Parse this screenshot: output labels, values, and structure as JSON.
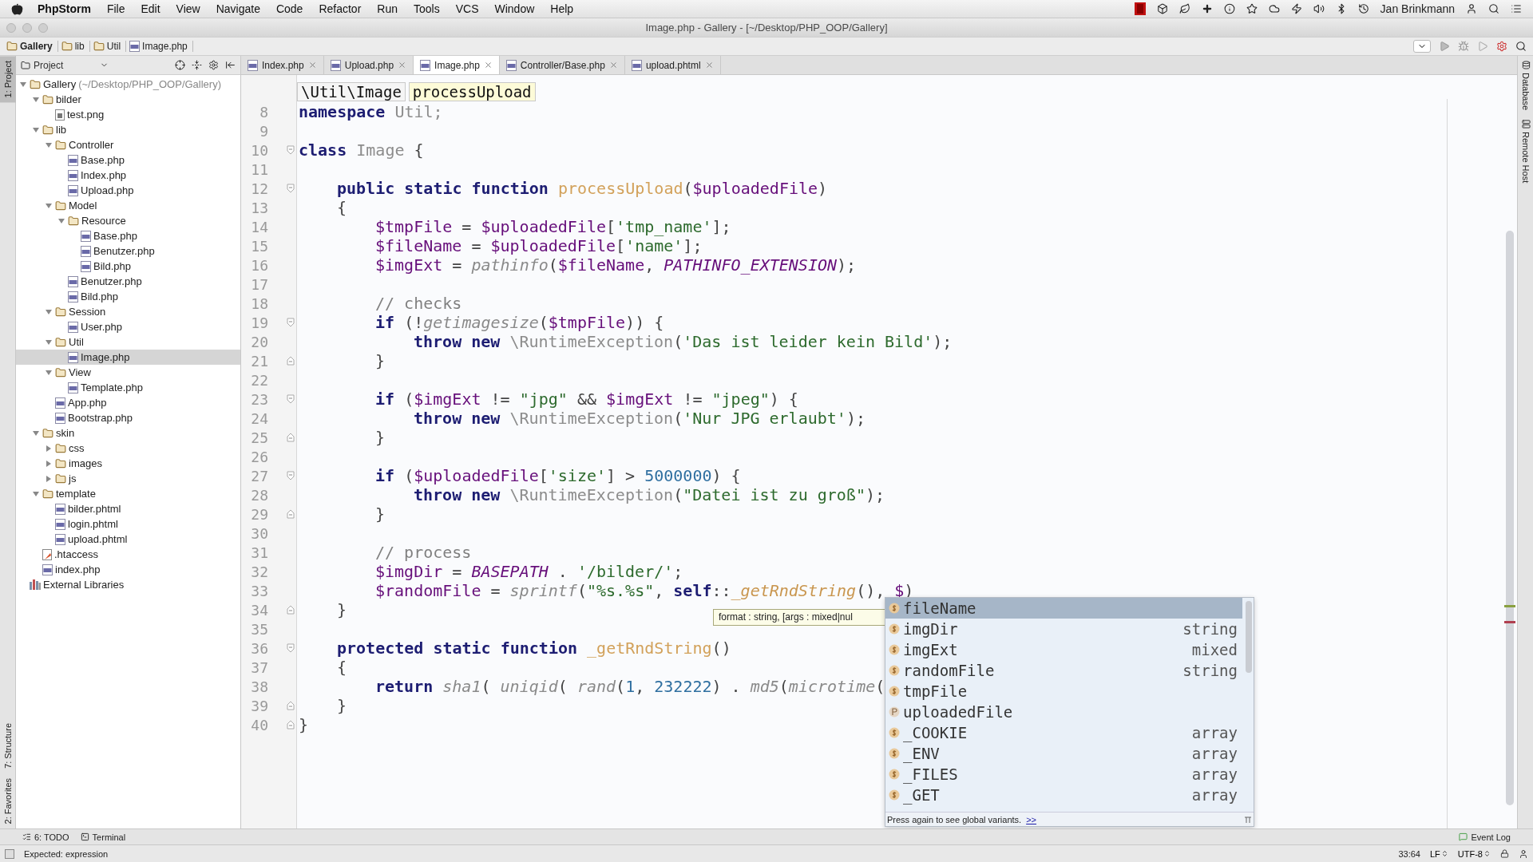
{
  "menu_bar": {
    "app": "PhpStorm",
    "items": [
      "File",
      "Edit",
      "View",
      "Navigate",
      "Code",
      "Refactor",
      "Run",
      "Tools",
      "VCS",
      "Window",
      "Help"
    ],
    "user": "Jan Brinkmann"
  },
  "window": {
    "title": "Image.php - Gallery - [~/Desktop/PHP_OOP/Gallery]"
  },
  "breadcrumbs": [
    "Gallery",
    "lib",
    "Util",
    "Image.php"
  ],
  "left_tool_strip": {
    "top": [
      {
        "label": "1: Project",
        "selected": true
      }
    ],
    "bottom": [
      {
        "label": "7: Structure",
        "selected": false
      },
      {
        "label": "2: Favorites",
        "selected": false
      }
    ]
  },
  "project_panel": {
    "title": "Project",
    "tree": [
      {
        "label": "Gallery",
        "hint": "(~/Desktop/PHP_OOP/Gallery)",
        "kind": "folder",
        "expanded": true,
        "selected": false,
        "children": [
          {
            "label": "bilder",
            "kind": "folder",
            "expanded": true,
            "selected": false,
            "children": [
              {
                "label": "test.png",
                "kind": "image",
                "selected": false
              }
            ]
          },
          {
            "label": "lib",
            "kind": "folder",
            "expanded": true,
            "selected": false,
            "children": [
              {
                "label": "Controller",
                "kind": "folder",
                "expanded": true,
                "selected": false,
                "children": [
                  {
                    "label": "Base.php",
                    "kind": "php",
                    "selected": false
                  },
                  {
                    "label": "Index.php",
                    "kind": "php",
                    "selected": false
                  },
                  {
                    "label": "Upload.php",
                    "kind": "php",
                    "selected": false
                  }
                ]
              },
              {
                "label": "Model",
                "kind": "folder",
                "expanded": true,
                "selected": false,
                "children": [
                  {
                    "label": "Resource",
                    "kind": "folder",
                    "expanded": true,
                    "selected": false,
                    "children": [
                      {
                        "label": "Base.php",
                        "kind": "php",
                        "selected": false
                      },
                      {
                        "label": "Benutzer.php",
                        "kind": "php",
                        "selected": false
                      },
                      {
                        "label": "Bild.php",
                        "kind": "php",
                        "selected": false
                      }
                    ]
                  },
                  {
                    "label": "Benutzer.php",
                    "kind": "php",
                    "selected": false
                  },
                  {
                    "label": "Bild.php",
                    "kind": "php",
                    "selected": false
                  }
                ]
              },
              {
                "label": "Session",
                "kind": "folder",
                "expanded": true,
                "selected": false,
                "children": [
                  {
                    "label": "User.php",
                    "kind": "php",
                    "selected": false
                  }
                ]
              },
              {
                "label": "Util",
                "kind": "folder",
                "expanded": true,
                "selected": false,
                "children": [
                  {
                    "label": "Image.php",
                    "kind": "php",
                    "selected": true
                  }
                ]
              },
              {
                "label": "View",
                "kind": "folder",
                "expanded": true,
                "selected": false,
                "children": [
                  {
                    "label": "Template.php",
                    "kind": "php",
                    "selected": false
                  }
                ]
              },
              {
                "label": "App.php",
                "kind": "php",
                "selected": false
              },
              {
                "label": "Bootstrap.php",
                "kind": "php",
                "selected": false
              }
            ]
          },
          {
            "label": "skin",
            "kind": "folder",
            "expanded": true,
            "selected": false,
            "children": [
              {
                "label": "css",
                "kind": "folder",
                "expanded": false,
                "selected": false
              },
              {
                "label": "images",
                "kind": "folder",
                "expanded": false,
                "selected": false
              },
              {
                "label": "js",
                "kind": "folder",
                "expanded": false,
                "selected": false
              }
            ]
          },
          {
            "label": "template",
            "kind": "folder",
            "expanded": true,
            "selected": false,
            "children": [
              {
                "label": "bilder.phtml",
                "kind": "php",
                "selected": false
              },
              {
                "label": "login.phtml",
                "kind": "php",
                "selected": false
              },
              {
                "label": "upload.phtml",
                "kind": "php",
                "selected": false
              }
            ]
          },
          {
            "label": ".htaccess",
            "kind": "config",
            "selected": false
          },
          {
            "label": "index.php",
            "kind": "php",
            "selected": false
          }
        ]
      },
      {
        "label": "External Libraries",
        "kind": "library",
        "selected": false
      }
    ]
  },
  "editor_tabs": [
    {
      "label": "Index.php",
      "selected": false
    },
    {
      "label": "Upload.php",
      "selected": false
    },
    {
      "label": "Image.php",
      "selected": true
    },
    {
      "label": "Controller/Base.php",
      "selected": false
    },
    {
      "label": "upload.phtml",
      "selected": false
    }
  ],
  "editor": {
    "breadcrumb": [
      "\\Util\\Image",
      "processUpload"
    ],
    "lines": [
      {
        "number": "8",
        "tokens": [
          {
            "kind": "kw",
            "text": "namespace"
          },
          {
            "kind": "cls",
            "text": " Util;"
          }
        ]
      },
      {
        "number": "9"
      },
      {
        "number": "10",
        "fold_start": true,
        "tokens": [
          {
            "kind": "kw",
            "text": "class"
          },
          {
            "kind": "cls",
            "text": " Image"
          },
          {
            "kind": "plain",
            "text": " {"
          }
        ],
        "children": [
          {
            "number": "11"
          },
          {
            "number": "12",
            "fold_start": true,
            "tokens": [
              {
                "kind": "kw",
                "text": "public static function"
              },
              {
                "kind": "fn",
                "text": " processUpload"
              },
              {
                "kind": "plain",
                "text": "("
              },
              {
                "kind": "var",
                "text": "$uploadedFile"
              },
              {
                "kind": "plain",
                "text": ")"
              }
            ]
          },
          {
            "number": "13",
            "tokens": [
              {
                "kind": "plain",
                "text": "{"
              }
            ],
            "children": [
              {
                "number": "14",
                "tokens": [
                  {
                    "kind": "var",
                    "text": "$tmpFile"
                  },
                  {
                    "kind": "plain",
                    "text": " = "
                  },
                  {
                    "kind": "var",
                    "text": "$uploadedFile"
                  },
                  {
                    "kind": "plain",
                    "text": "["
                  },
                  {
                    "kind": "str",
                    "text": "'tmp_name'"
                  },
                  {
                    "kind": "plain",
                    "text": "];"
                  }
                ]
              },
              {
                "number": "15",
                "tokens": [
                  {
                    "kind": "var",
                    "text": "$fileName"
                  },
                  {
                    "kind": "plain",
                    "text": " = "
                  },
                  {
                    "kind": "var",
                    "text": "$uploadedFile"
                  },
                  {
                    "kind": "plain",
                    "text": "["
                  },
                  {
                    "kind": "str",
                    "text": "'name'"
                  },
                  {
                    "kind": "plain",
                    "text": "];"
                  }
                ]
              },
              {
                "number": "16",
                "tokens": [
                  {
                    "kind": "var",
                    "text": "$imgExt"
                  },
                  {
                    "kind": "plain",
                    "text": " = "
                  },
                  {
                    "kind": "call",
                    "text": "pathinfo"
                  },
                  {
                    "kind": "plain",
                    "text": "("
                  },
                  {
                    "kind": "var",
                    "text": "$fileName"
                  },
                  {
                    "kind": "plain",
                    "text": ", "
                  },
                  {
                    "kind": "const",
                    "text": "PATHINFO_EXTENSION"
                  },
                  {
                    "kind": "plain",
                    "text": ");"
                  }
                ]
              },
              {
                "number": "17"
              },
              {
                "number": "18",
                "tokens": [
                  {
                    "kind": "cmt",
                    "text": "// checks"
                  }
                ]
              },
              {
                "number": "19",
                "fold_start": true,
                "tokens": [
                  {
                    "kind": "kw",
                    "text": "if"
                  },
                  {
                    "kind": "plain",
                    "text": " (!"
                  },
                  {
                    "kind": "call",
                    "text": "getimagesize"
                  },
                  {
                    "kind": "plain",
                    "text": "("
                  },
                  {
                    "kind": "var",
                    "text": "$tmpFile"
                  },
                  {
                    "kind": "plain",
                    "text": ")) {"
                  }
                ],
                "children": [
                  {
                    "number": "20",
                    "tokens": [
                      {
                        "kind": "kw",
                        "text": "throw new"
                      },
                      {
                        "kind": "cls",
                        "text": " \\RuntimeException"
                      },
                      {
                        "kind": "plain",
                        "text": "("
                      },
                      {
                        "kind": "str",
                        "text": "'Das ist leider kein Bild'"
                      },
                      {
                        "kind": "plain",
                        "text": ");"
                      }
                    ]
                  }
                ]
              },
              {
                "number": "21",
                "fold_end": true,
                "tokens": [
                  {
                    "kind": "plain",
                    "text": "}"
                  }
                ]
              },
              {
                "number": "22"
              },
              {
                "number": "23",
                "fold_start": true,
                "tokens": [
                  {
                    "kind": "kw",
                    "text": "if"
                  },
                  {
                    "kind": "plain",
                    "text": " ("
                  },
                  {
                    "kind": "var",
                    "text": "$imgExt"
                  },
                  {
                    "kind": "plain",
                    "text": " != "
                  },
                  {
                    "kind": "str",
                    "text": "\"jpg\""
                  },
                  {
                    "kind": "plain",
                    "text": " && "
                  },
                  {
                    "kind": "var",
                    "text": "$imgExt"
                  },
                  {
                    "kind": "plain",
                    "text": " != "
                  },
                  {
                    "kind": "str",
                    "text": "\"jpeg\""
                  },
                  {
                    "kind": "plain",
                    "text": ") {"
                  }
                ],
                "children": [
                  {
                    "number": "24",
                    "tokens": [
                      {
                        "kind": "kw",
                        "text": "throw new"
                      },
                      {
                        "kind": "cls",
                        "text": " \\RuntimeException"
                      },
                      {
                        "kind": "plain",
                        "text": "("
                      },
                      {
                        "kind": "str",
                        "text": "'Nur JPG erlaubt'"
                      },
                      {
                        "kind": "plain",
                        "text": ");"
                      }
                    ]
                  }
                ]
              },
              {
                "number": "25",
                "fold_end": true,
                "tokens": [
                  {
                    "kind": "plain",
                    "text": "}"
                  }
                ]
              },
              {
                "number": "26"
              },
              {
                "number": "27",
                "fold_start": true,
                "tokens": [
                  {
                    "kind": "kw",
                    "text": "if"
                  },
                  {
                    "kind": "plain",
                    "text": " ("
                  },
                  {
                    "kind": "var",
                    "text": "$uploadedFile"
                  },
                  {
                    "kind": "plain",
                    "text": "["
                  },
                  {
                    "kind": "str",
                    "text": "'size'"
                  },
                  {
                    "kind": "plain",
                    "text": "] > "
                  },
                  {
                    "kind": "num",
                    "text": "5000000"
                  },
                  {
                    "kind": "plain",
                    "text": ") {"
                  }
                ],
                "children": [
                  {
                    "number": "28",
                    "tokens": [
                      {
                        "kind": "kw",
                        "text": "throw new"
                      },
                      {
                        "kind": "cls",
                        "text": " \\RuntimeException"
                      },
                      {
                        "kind": "plain",
                        "text": "("
                      },
                      {
                        "kind": "str",
                        "text": "\"Datei ist zu groß\""
                      },
                      {
                        "kind": "plain",
                        "text": ");"
                      }
                    ]
                  }
                ]
              },
              {
                "number": "29",
                "fold_end": true,
                "tokens": [
                  {
                    "kind": "plain",
                    "text": "}"
                  }
                ]
              },
              {
                "number": "30"
              },
              {
                "number": "31",
                "tokens": [
                  {
                    "kind": "cmt",
                    "text": "// process"
                  }
                ]
              },
              {
                "number": "32",
                "tokens": [
                  {
                    "kind": "var",
                    "text": "$imgDir"
                  },
                  {
                    "kind": "plain",
                    "text": " = "
                  },
                  {
                    "kind": "const",
                    "text": "BASEPATH"
                  },
                  {
                    "kind": "plain",
                    "text": " . "
                  },
                  {
                    "kind": "str",
                    "text": "'/bilder/'"
                  },
                  {
                    "kind": "plain",
                    "text": ";"
                  }
                ]
              },
              {
                "number": "33",
                "tokens": [
                  {
                    "kind": "var",
                    "text": "$randomFile"
                  },
                  {
                    "kind": "plain",
                    "text": " = "
                  },
                  {
                    "kind": "call",
                    "text": "sprintf"
                  },
                  {
                    "kind": "plain",
                    "text": "("
                  },
                  {
                    "kind": "str",
                    "text": "\"%s.%s\""
                  },
                  {
                    "kind": "plain",
                    "text": ", "
                  },
                  {
                    "kind": "kw",
                    "text": "self"
                  },
                  {
                    "kind": "plain",
                    "text": "::"
                  },
                  {
                    "kind": "scall",
                    "text": "_getRndString"
                  },
                  {
                    "kind": "plain",
                    "text": "(), "
                  },
                  {
                    "kind": "var",
                    "text": "$"
                  },
                  {
                    "kind": "plain",
                    "text": ")"
                  }
                ]
              }
            ]
          },
          {
            "number": "34",
            "fold_end": true,
            "tokens": [
              {
                "kind": "plain",
                "text": "}"
              }
            ]
          },
          {
            "number": "35"
          },
          {
            "number": "36",
            "fold_start": true,
            "tokens": [
              {
                "kind": "kw",
                "text": "protected static function"
              },
              {
                "kind": "fn",
                "text": " _getRndString"
              },
              {
                "kind": "plain",
                "text": "()"
              }
            ]
          },
          {
            "number": "37",
            "tokens": [
              {
                "kind": "plain",
                "text": "{"
              }
            ],
            "children": [
              {
                "number": "38",
                "tokens": [
                  {
                    "kind": "kw",
                    "text": "return"
                  },
                  {
                    "kind": "call",
                    "text": " sha1"
                  },
                  {
                    "kind": "plain",
                    "text": "( "
                  },
                  {
                    "kind": "call",
                    "text": "uniqid"
                  },
                  {
                    "kind": "plain",
                    "text": "( "
                  },
                  {
                    "kind": "call",
                    "text": "rand"
                  },
                  {
                    "kind": "plain",
                    "text": "("
                  },
                  {
                    "kind": "num",
                    "text": "1"
                  },
                  {
                    "kind": "plain",
                    "text": ", "
                  },
                  {
                    "kind": "num",
                    "text": "232222"
                  },
                  {
                    "kind": "plain",
                    "text": ") . "
                  },
                  {
                    "kind": "call",
                    "text": "md5"
                  },
                  {
                    "kind": "plain",
                    "text": "("
                  },
                  {
                    "kind": "call",
                    "text": "microtime"
                  },
                  {
                    "kind": "plain",
                    "text": "("
                  }
                ]
              }
            ]
          },
          {
            "number": "39",
            "fold_end": true,
            "tokens": [
              {
                "kind": "plain",
                "text": "}"
              }
            ]
          }
        ]
      },
      {
        "number": "40",
        "fold_end": true,
        "tokens": [
          {
            "kind": "plain",
            "text": "}"
          }
        ]
      }
    ],
    "tooltip": "format : string, [args : mixed|nul",
    "completion": {
      "items": [
        {
          "name": "fileName",
          "kind": "variable",
          "selected": true
        },
        {
          "name": "imgDir",
          "type": "string",
          "kind": "variable",
          "selected": false
        },
        {
          "name": "imgExt",
          "type": "mixed",
          "kind": "variable",
          "selected": false
        },
        {
          "name": "randomFile",
          "type": "string",
          "kind": "variable",
          "selected": false
        },
        {
          "name": "tmpFile",
          "kind": "variable",
          "selected": false
        },
        {
          "name": "uploadedFile",
          "kind": "parameter",
          "selected": false
        },
        {
          "name": "_COOKIE",
          "type": "array",
          "kind": "variable",
          "selected": false
        },
        {
          "name": "_ENV",
          "type": "array",
          "kind": "variable",
          "selected": false
        },
        {
          "name": "_FILES",
          "type": "array",
          "kind": "variable",
          "selected": false
        },
        {
          "name": "_GET",
          "type": "array",
          "kind": "variable",
          "selected": false
        }
      ],
      "footer": "Press again to see global variants.",
      "footer_link": ">>"
    }
  },
  "right_tool_strip": [
    "Database",
    "Remote Host"
  ],
  "bottom_tools": {
    "left": [
      "6: TODO",
      "Terminal"
    ],
    "right": "Event Log"
  },
  "status_bar": {
    "message": "Expected: expression",
    "position": "33:64",
    "line_separator": "LF",
    "encoding": "UTF-8"
  }
}
